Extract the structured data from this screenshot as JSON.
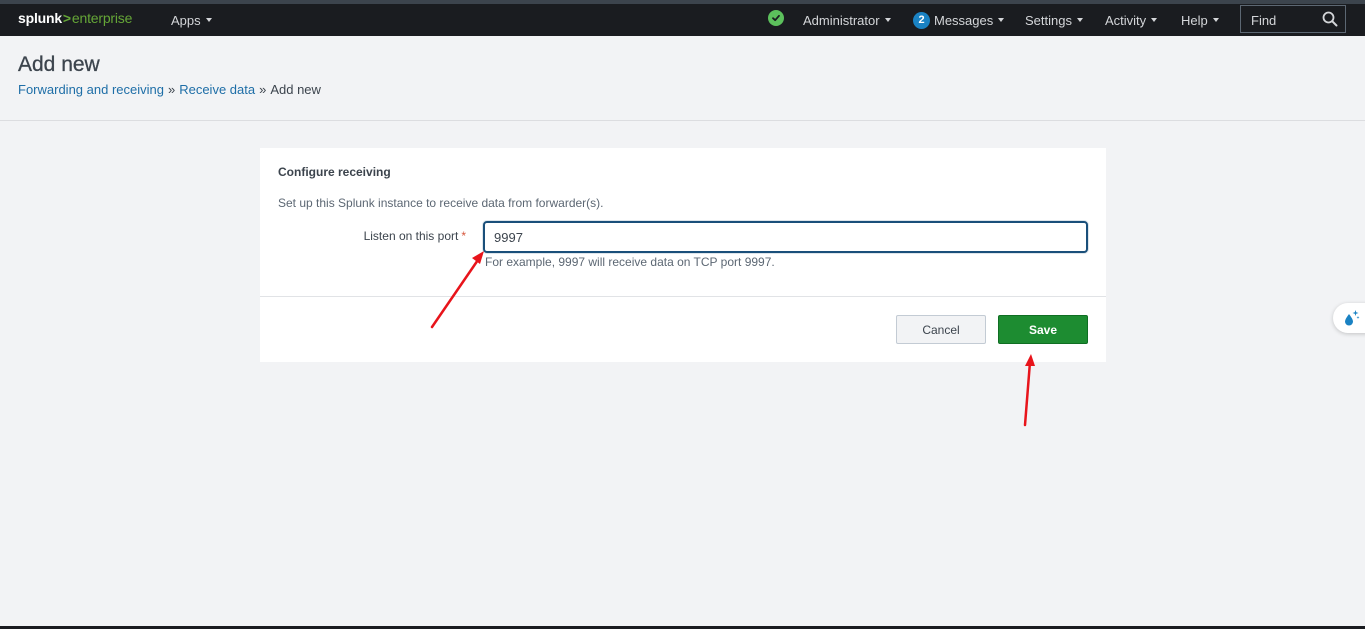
{
  "navbar": {
    "logo_part1": "splunk",
    "logo_part2": ">",
    "logo_part3": "enterprise",
    "apps_label": "Apps",
    "user_label": "Administrator",
    "messages_count": "2",
    "messages_label": "Messages",
    "settings_label": "Settings",
    "activity_label": "Activity",
    "help_label": "Help",
    "find_placeholder": "Find",
    "status_color": "#5cc05c",
    "badge_color": "#1a82c3"
  },
  "page": {
    "title": "Add new",
    "breadcrumb": [
      {
        "label": "Forwarding and receiving",
        "link": true
      },
      {
        "label": "Receive data",
        "link": true
      },
      {
        "label": "Add new",
        "link": false
      }
    ],
    "breadcrumb_separator": "»"
  },
  "form": {
    "section_title": "Configure receiving",
    "description": "Set up this Splunk instance to receive data from forwarder(s).",
    "port_label": "Listen on this port",
    "required_mark": "*",
    "port_value": "9997",
    "port_help": "For example, 9997 will receive data on TCP port 9997.",
    "cancel_label": "Cancel",
    "save_label": "Save",
    "save_color": "#1d8c31"
  },
  "annotations": {
    "arrow_color": "#e8141b"
  },
  "icons": {
    "status": "check-circle-icon",
    "search": "search-icon",
    "side_widget": "water-drop-sparkle-icon"
  }
}
